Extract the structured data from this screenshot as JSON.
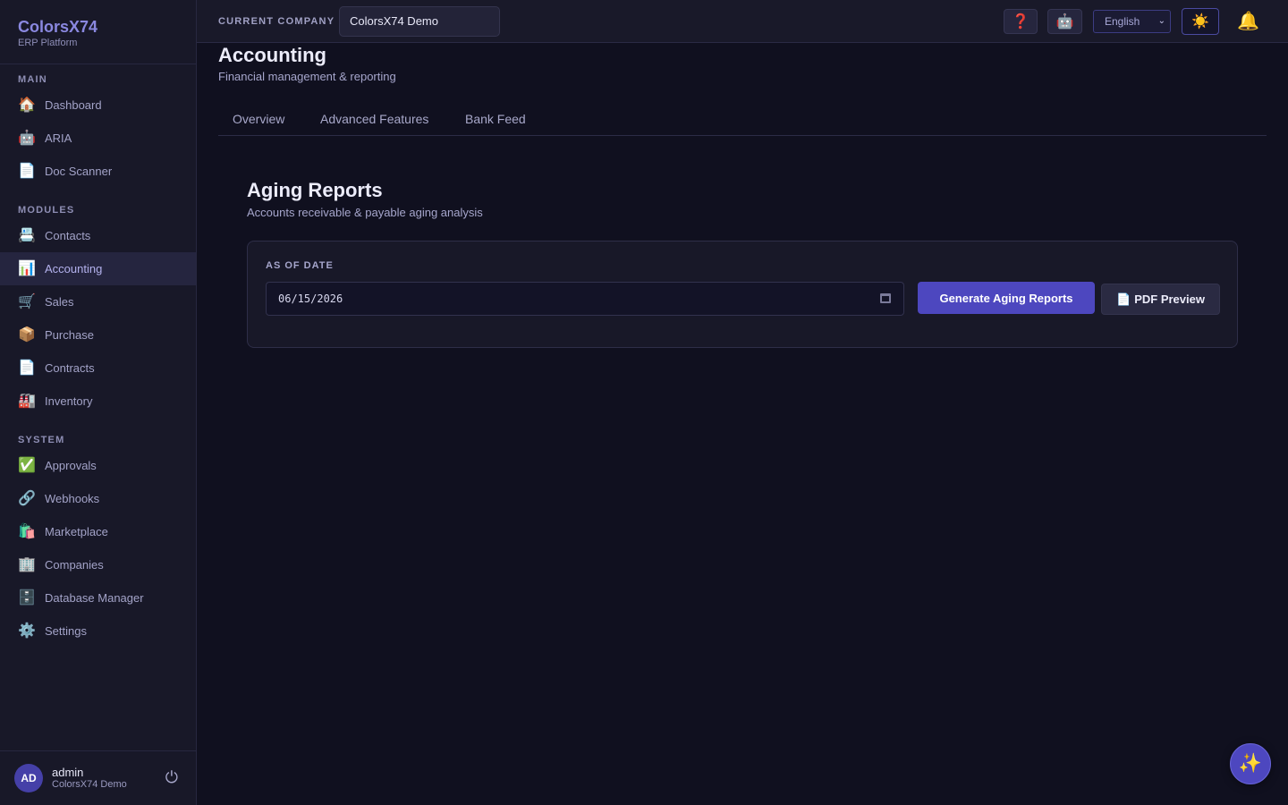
{
  "brand": {
    "name": "ColorsX74",
    "subtitle": "ERP Platform"
  },
  "sidebar": {
    "sections": [
      {
        "label": "MAIN",
        "items": [
          {
            "label": "Dashboard",
            "icon": "house-icon",
            "glyph": "🏠"
          },
          {
            "label": "ARIA",
            "icon": "robot-icon",
            "glyph": "🤖"
          },
          {
            "label": "Doc Scanner",
            "icon": "document-icon",
            "glyph": "📄"
          }
        ]
      },
      {
        "label": "MODULES",
        "items": [
          {
            "label": "Contacts",
            "icon": "contact-card-icon",
            "glyph": "📇"
          },
          {
            "label": "Accounting",
            "icon": "bar-chart-icon",
            "glyph": "📊",
            "active": true
          },
          {
            "label": "Sales",
            "icon": "shopping-cart-icon",
            "glyph": "🛒"
          },
          {
            "label": "Purchase",
            "icon": "package-icon",
            "glyph": "📦"
          },
          {
            "label": "Contracts",
            "icon": "document-icon",
            "glyph": "📄"
          },
          {
            "label": "Inventory",
            "icon": "factory-icon",
            "glyph": "🏭"
          }
        ]
      },
      {
        "label": "SYSTEM",
        "items": [
          {
            "label": "Approvals",
            "icon": "check-mark-icon",
            "glyph": "✅"
          },
          {
            "label": "Webhooks",
            "icon": "link-icon",
            "glyph": "🔗"
          },
          {
            "label": "Marketplace",
            "icon": "shopping-bags-icon",
            "glyph": "🛍️"
          },
          {
            "label": "Companies",
            "icon": "office-building-icon",
            "glyph": "🏢"
          },
          {
            "label": "Database Manager",
            "icon": "file-cabinet-icon",
            "glyph": "🗄️"
          },
          {
            "label": "Settings",
            "icon": "gear-icon",
            "glyph": "⚙️"
          }
        ]
      }
    ]
  },
  "user": {
    "initials": "AD",
    "name": "admin",
    "company": "ColorsX74 Demo",
    "logout_icon": "power-icon",
    "logout_glyph": "⏻"
  },
  "topbar": {
    "company_label": "CURRENT COMPANY",
    "company_value": "ColorsX74 Demo",
    "help_glyph": "❓",
    "assistant_glyph": "🤖",
    "language": "English",
    "theme_glyph": "☀️",
    "bell_glyph": "🔔"
  },
  "page": {
    "title": "Accounting",
    "subtitle": "Financial management & reporting",
    "tabs": [
      "Overview",
      "Advanced Features",
      "Bank Feed"
    ]
  },
  "section": {
    "title": "Aging Reports",
    "subtitle": "Accounts receivable & payable aging analysis",
    "field_label": "AS OF DATE",
    "date_value": "06/15/2026",
    "generate_label": "Generate Aging Reports",
    "pdf_label": "PDF Preview",
    "pdf_glyph": "📄"
  },
  "fab": {
    "glyph": "✨"
  },
  "colors": {
    "accent": "#4d47bf",
    "background": "#10101f",
    "sidebar": "#181828",
    "brand": "#8a88e0"
  }
}
